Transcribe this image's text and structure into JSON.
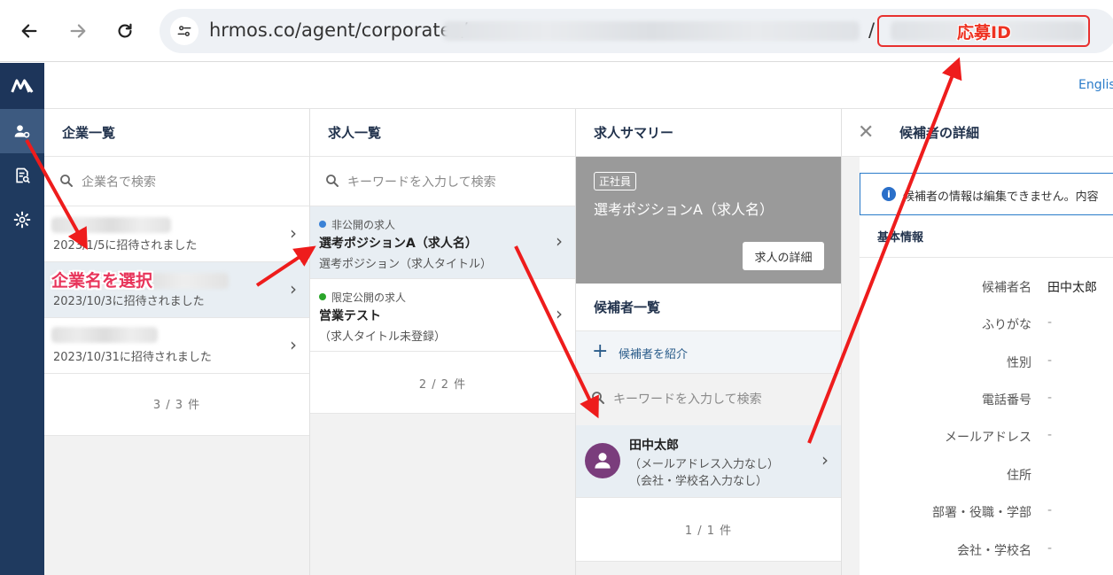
{
  "browser": {
    "url_prefix": "hrmos.co/agent/corporates/",
    "url_slash": "/",
    "annotation_label": "応募ID"
  },
  "app": {
    "language_link": "English"
  },
  "companies": {
    "title": "企業一覧",
    "search_placeholder": "企業名で検索",
    "rows": [
      {
        "date": "2023/1/5に招待されました"
      },
      {
        "date": "2023/10/3に招待されました"
      },
      {
        "date": "2023/10/31に招待されました"
      }
    ],
    "count": "3 / 3 件",
    "annotation": "企業名を選択"
  },
  "jobs": {
    "title": "求人一覧",
    "search_placeholder": "キーワードを入力して検索",
    "items": [
      {
        "status": "非公開の求人",
        "status_color": "#3b82d6",
        "name": "選考ポジションA（求人名）",
        "sub": "選考ポジション（求人タイトル）"
      },
      {
        "status": "限定公開の求人",
        "status_color": "#2aa52a",
        "name": "営業テスト",
        "sub": "（求人タイトル未登録）"
      }
    ],
    "count": "2 / 2 件"
  },
  "summary": {
    "title": "求人サマリー",
    "badge": "正社員",
    "job_title": "選考ポジションA（求人名）",
    "detail_button": "求人の詳細",
    "candidates_title": "候補者一覧",
    "add_candidate": "候補者を紹介",
    "search_placeholder": "キーワードを入力して検索",
    "candidate": {
      "name": "田中太郎",
      "email": "（メールアドレス入力なし）",
      "company": "（会社・学校名入力なし）"
    },
    "count": "1 / 1 件"
  },
  "detail": {
    "title": "候補者の詳細",
    "notice": "候補者の情報は編集できません。内容",
    "section": "基本情報",
    "fields": [
      {
        "label": "候補者名",
        "value": "田中太郎"
      },
      {
        "label": "ふりがな",
        "value": "-"
      },
      {
        "label": "性別",
        "value": "-"
      },
      {
        "label": "電話番号",
        "value": "-"
      },
      {
        "label": "メールアドレス",
        "value": "-"
      },
      {
        "label": "住所",
        "value": ""
      },
      {
        "label": "部署・役職・学部",
        "value": "-"
      },
      {
        "label": "会社・学校名",
        "value": "-"
      }
    ]
  },
  "colors": {
    "sidebar": "#1f3a5f",
    "accent": "#2a7bc9",
    "annotation": "#e8312f"
  }
}
